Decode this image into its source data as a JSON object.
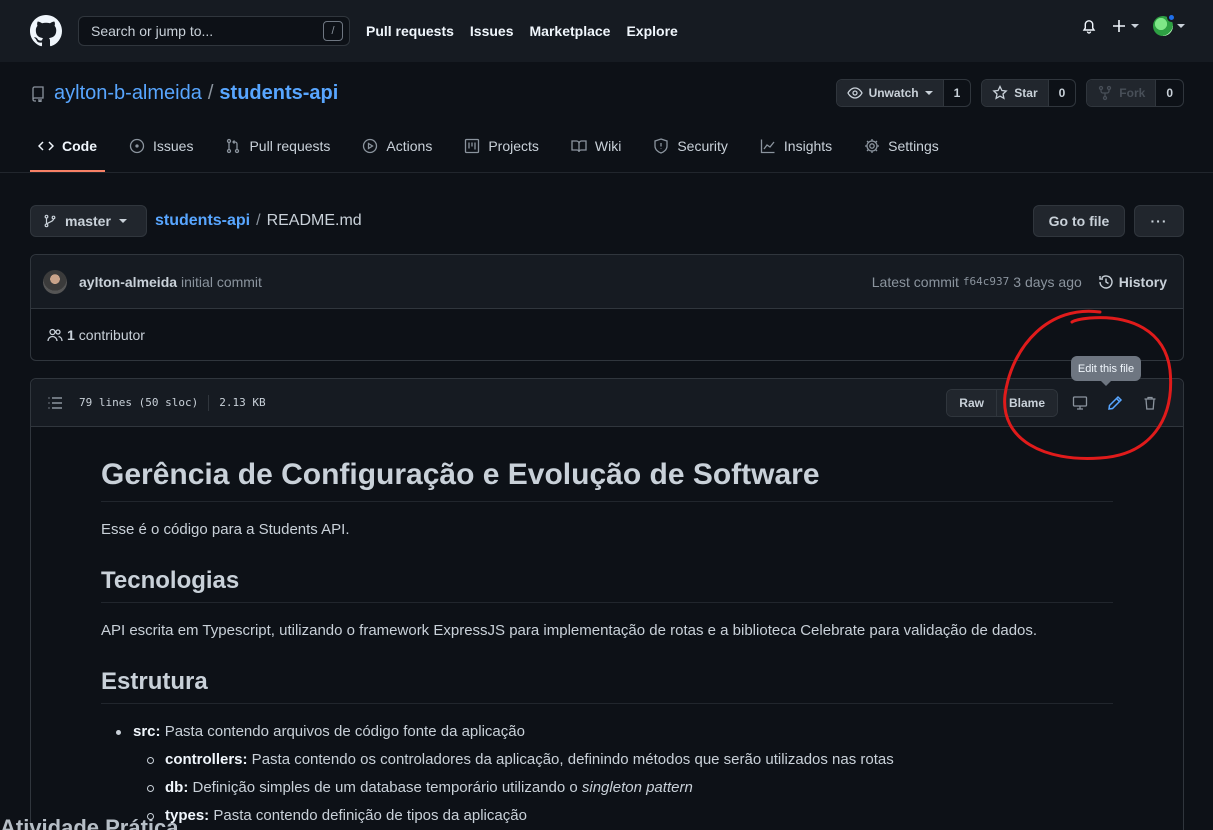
{
  "header": {
    "search_placeholder": "Search or jump to...",
    "search_shortcut": "/",
    "nav": [
      "Pull requests",
      "Issues",
      "Marketplace",
      "Explore"
    ]
  },
  "repo": {
    "owner": "aylton-b-almeida",
    "separator": "/",
    "name": "students-api",
    "unwatch_label": "Unwatch",
    "watch_count": "1",
    "star_label": "Star",
    "star_count": "0",
    "fork_label": "Fork",
    "fork_count": "0"
  },
  "tabs": [
    {
      "label": "Code",
      "icon": "code-icon",
      "active": true
    },
    {
      "label": "Issues",
      "icon": "issue-icon"
    },
    {
      "label": "Pull requests",
      "icon": "pull-request-icon"
    },
    {
      "label": "Actions",
      "icon": "play-icon"
    },
    {
      "label": "Projects",
      "icon": "project-icon"
    },
    {
      "label": "Wiki",
      "icon": "book-icon"
    },
    {
      "label": "Security",
      "icon": "shield-icon"
    },
    {
      "label": "Insights",
      "icon": "graph-icon"
    },
    {
      "label": "Settings",
      "icon": "gear-icon"
    }
  ],
  "breadcrumb": {
    "branch": "master",
    "repo": "students-api",
    "sep": "/",
    "file": "README.md",
    "goto_label": "Go to file",
    "more_label": "···"
  },
  "commit": {
    "user": "aylton-almeida",
    "message": "initial commit",
    "latest_label": "Latest commit",
    "sha": "f64c937",
    "time": "3 days ago",
    "history_label": "History",
    "contributors_count": "1",
    "contributors_label": "contributor"
  },
  "file": {
    "lines": "79 lines (50 sloc)",
    "size": "2.13 KB",
    "raw_label": "Raw",
    "blame_label": "Blame",
    "tooltip": "Edit this file"
  },
  "readme": {
    "title": "Gerência de Configuração e Evolução de Software",
    "intro": "Esse é o código para a Students API.",
    "h_tech": "Tecnologias",
    "tech_text": "API escrita em Typescript, utilizando o framework ExpressJS para implementação de rotas e a biblioteca Celebrate para validação de dados.",
    "h_struct": "Estrutura",
    "src_term": "src:",
    "src_desc": " Pasta contendo arquivos de código fonte da aplicação",
    "controllers_term": "controllers:",
    "controllers_desc": " Pasta contendo os controladores da aplicação, definindo métodos que serão utilizados nas rotas",
    "db_term": "db:",
    "db_desc": " Definição simples de um database temporário utilizando o ",
    "db_em": "singleton pattern",
    "types_term": "types:",
    "types_desc": " Pasta contendo definição de tipos da aplicação",
    "ghost_text": "Atividade Prática"
  },
  "colors": {
    "accent": "#58a6ff",
    "tab_underline": "#f78166",
    "annotation": "#e01b1b"
  }
}
